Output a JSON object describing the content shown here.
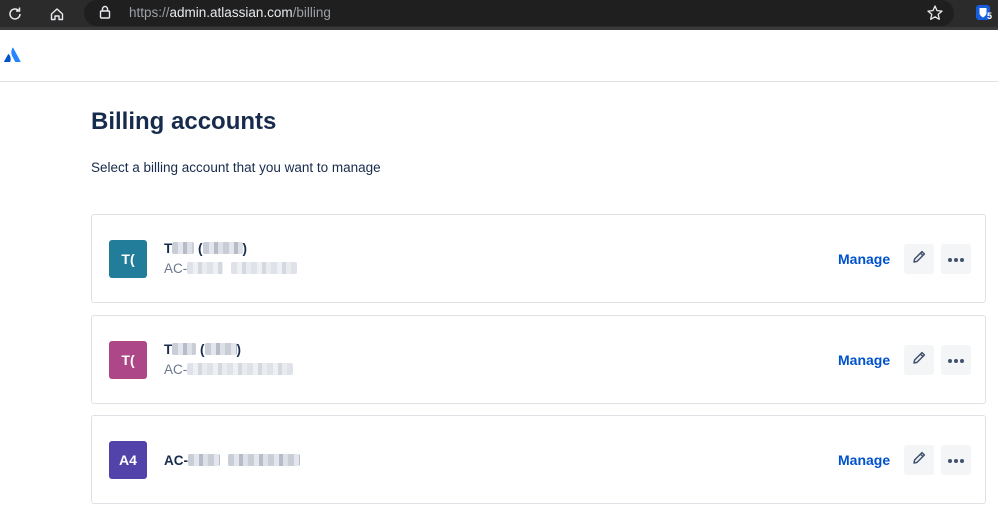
{
  "browser": {
    "url_scheme": "https://",
    "url_host": "admin.atlassian.com",
    "url_path": "/billing",
    "extension_badge": "5"
  },
  "page": {
    "title": "Billing accounts",
    "subtitle": "Select a billing account that you want to manage"
  },
  "accounts": [
    {
      "initials": "T(",
      "name_prefix": "T",
      "name_open": "(",
      "name_close": ")",
      "id_prefix": "AC-",
      "manage_label": "Manage",
      "color": "#227d9b"
    },
    {
      "initials": "T(",
      "name_prefix": "T",
      "name_open": "(",
      "name_close": ")",
      "id_prefix": "AC-",
      "manage_label": "Manage",
      "color": "#ae4787"
    },
    {
      "initials": "A4",
      "id_prefix": "AC-",
      "manage_label": "Manage",
      "color": "#5243aa"
    }
  ],
  "colors": {
    "link": "#0052cc",
    "text": "#172b4d",
    "brand": "#2684ff"
  },
  "icons": [
    "reload-icon",
    "home-icon",
    "lock-icon",
    "star-icon",
    "extension-icon",
    "atlassian-logo",
    "pencil-icon",
    "more-icon"
  ]
}
